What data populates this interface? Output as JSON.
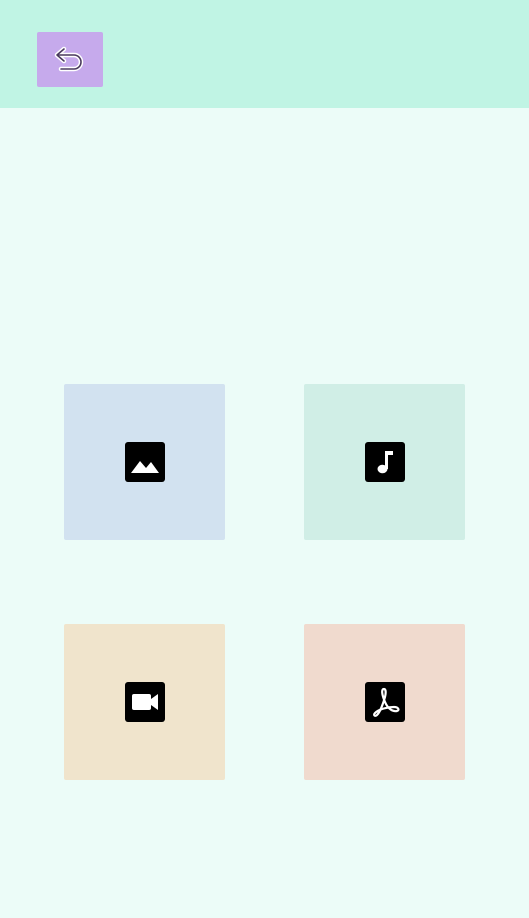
{
  "colors": {
    "page_background": "#ecfcf8",
    "header_background": "#c0f4e4",
    "back_button_background": "#c6aaec"
  },
  "header": {
    "back_button": {
      "icon": "undo-arrow-icon"
    }
  },
  "tiles": [
    {
      "id": "image",
      "icon": "image-icon",
      "background": "#d2e2f0"
    },
    {
      "id": "audio",
      "icon": "music-note-icon",
      "background": "#d0eee6"
    },
    {
      "id": "video",
      "icon": "video-camera-icon",
      "background": "#f0e4cc"
    },
    {
      "id": "pdf",
      "icon": "pdf-icon",
      "background": "#f0dace"
    }
  ]
}
